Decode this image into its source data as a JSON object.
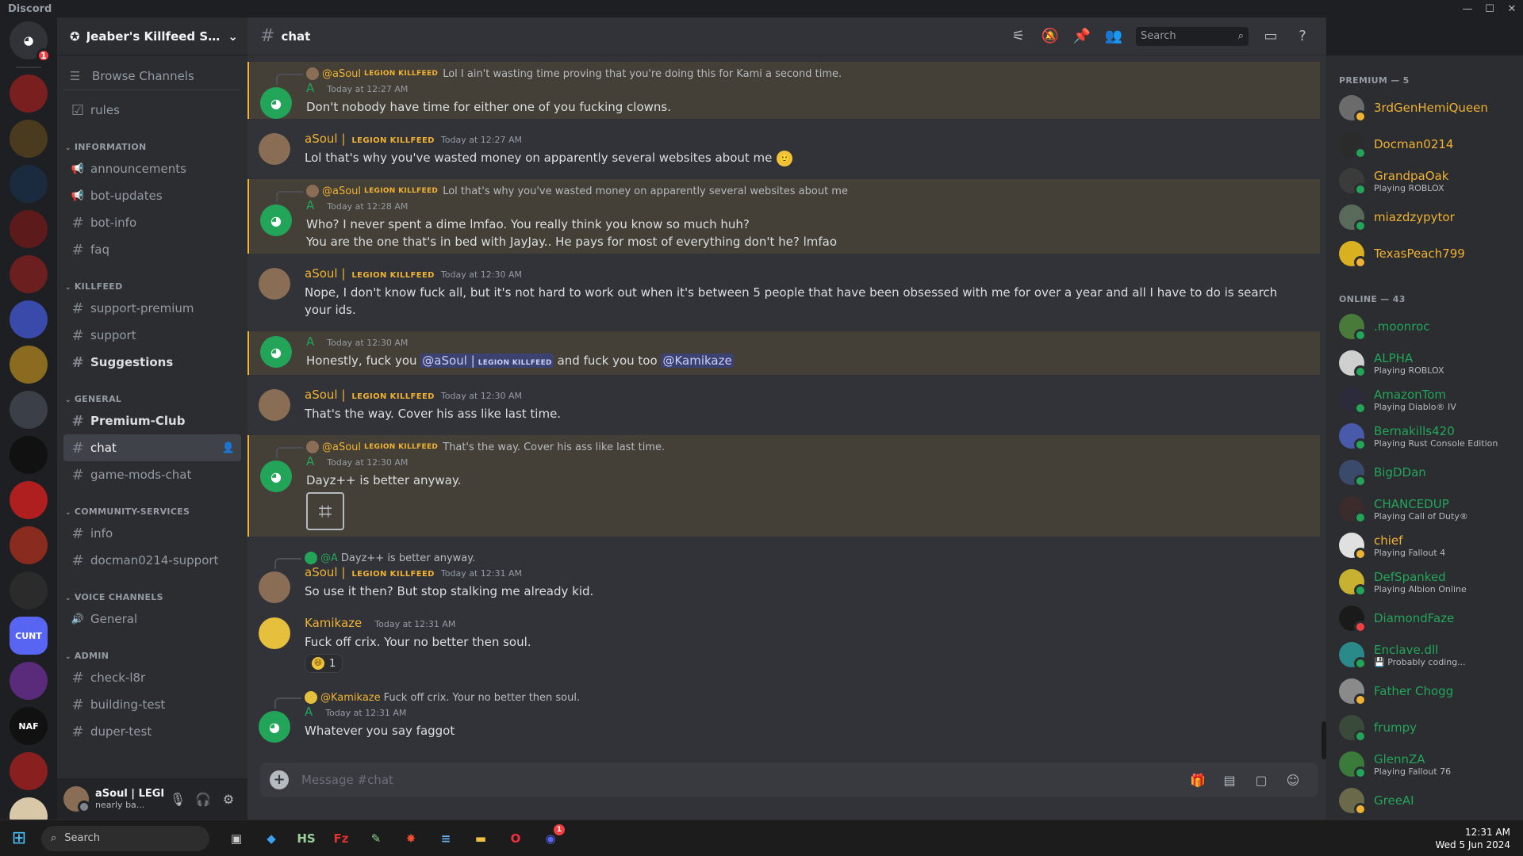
{
  "window": {
    "app_name": "Discord",
    "controls": [
      "—",
      "☐",
      "✕"
    ]
  },
  "servers": [
    {
      "label": "",
      "icon": "discord-home-icon",
      "color": "#313338",
      "badge": "1"
    },
    {
      "label": "",
      "icon": "server-skull-icon",
      "color": "#7a1f1f"
    },
    {
      "label": "",
      "icon": "server-emblem-icon",
      "color": "#4a3b1e"
    },
    {
      "label": "",
      "icon": "server-deathmatch-icon",
      "color": "#1a2b3f"
    },
    {
      "label": "",
      "icon": "server-dayz-icon",
      "color": "#5c1a1a"
    },
    {
      "label": "",
      "icon": "server-skull-red-icon",
      "color": "#6b1f1f"
    },
    {
      "label": "",
      "icon": "folder-icon",
      "color": "#3a4aaa"
    },
    {
      "label": "",
      "icon": "server-gold-icon",
      "color": "#8a6b1f"
    },
    {
      "label": "",
      "icon": "server-mask-icon",
      "color": "#3b4048"
    },
    {
      "label": "",
      "icon": "server-anarchy-icon",
      "color": "#111111"
    },
    {
      "label": "",
      "icon": "server-red-icon",
      "color": "#b01f1f"
    },
    {
      "label": "",
      "icon": "server-target-icon",
      "color": "#8a2b1f"
    },
    {
      "label": "",
      "icon": "server-skull-crown-icon",
      "color": "#2b2b2b"
    },
    {
      "label": "CUNT",
      "icon": "server-text-icon",
      "color": "#5865f2"
    },
    {
      "label": "",
      "icon": "server-purple-icon",
      "color": "#5a2b7a"
    },
    {
      "label": "NAF",
      "icon": "server-naf-icon",
      "color": "#111111"
    },
    {
      "label": "",
      "icon": "server-demon-icon",
      "color": "#8a1f1f"
    },
    {
      "label": "",
      "icon": "server-poster-icon",
      "color": "#d8c8a8"
    }
  ],
  "server": {
    "name": "Jeaber's Killfeed Sup..."
  },
  "sidebar": {
    "browse": "Browse Channels",
    "top_channels": [
      {
        "name": "rules",
        "icon": "rules-icon",
        "glyph": "☑"
      }
    ],
    "categories": [
      {
        "name": "INFORMATION",
        "channels": [
          {
            "name": "announcements",
            "glyph": "📢",
            "icon": "announcement-icon"
          },
          {
            "name": "bot-updates",
            "glyph": "📢",
            "icon": "announcement-icon"
          },
          {
            "name": "bot-info",
            "glyph": "#",
            "icon": "text-channel-icon"
          },
          {
            "name": "faq",
            "glyph": "#",
            "icon": "text-channel-icon"
          }
        ]
      },
      {
        "name": "KILLFEED",
        "channels": [
          {
            "name": "support-premium",
            "glyph": "#",
            "icon": "text-channel-icon"
          },
          {
            "name": "support",
            "glyph": "#",
            "icon": "text-channel-icon"
          },
          {
            "name": "Suggestions",
            "glyph": "#",
            "icon": "text-channel-icon",
            "bold": true
          }
        ]
      },
      {
        "name": "GENERAL",
        "channels": [
          {
            "name": "Premium-Club",
            "glyph": "#",
            "icon": "text-channel-icon",
            "bold": true
          },
          {
            "name": "chat",
            "glyph": "#",
            "icon": "text-channel-icon",
            "active": true
          },
          {
            "name": "game-mods-chat",
            "glyph": "#",
            "icon": "text-channel-icon"
          }
        ]
      },
      {
        "name": "COMMUNITY-SERVICES",
        "channels": [
          {
            "name": "info",
            "glyph": "#",
            "icon": "text-channel-icon"
          },
          {
            "name": "docman0214-support",
            "glyph": "#",
            "icon": "text-channel-icon"
          }
        ]
      },
      {
        "name": "VOICE CHANNELS",
        "channels": [
          {
            "name": "General",
            "glyph": "🔊",
            "icon": "voice-channel-icon"
          }
        ]
      },
      {
        "name": "ADMIN",
        "channels": [
          {
            "name": "check-l8r",
            "glyph": "#",
            "icon": "text-channel-icon"
          },
          {
            "name": "building-test",
            "glyph": "#",
            "icon": "text-channel-icon"
          },
          {
            "name": "duper-test",
            "glyph": "#",
            "icon": "text-channel-icon"
          }
        ]
      }
    ]
  },
  "user_panel": {
    "username": "aSoul | LEGI...",
    "status": "nearly ba..."
  },
  "chat": {
    "channel": "chat",
    "search_placeholder": "Search",
    "composer_placeholder": "Message #chat"
  },
  "messages": [
    {
      "highlight": true,
      "reply": {
        "name": "@aSoul",
        "tag": "LEGION KILLFEED",
        "text": "Lol I ain't wasting time proving that you're doing this for Kami a second time."
      },
      "author": "A",
      "author_style": "green",
      "avatar": "discord",
      "timestamp": "Today at 12:27 AM",
      "lines": [
        "Don't nobody have time for either one of you fucking clowns."
      ]
    },
    {
      "author": "aSoul |",
      "tag": "LEGION KILLFEED",
      "avatar": "soul",
      "timestamp": "Today at 12:27 AM",
      "lines": [
        "Lol that's why you've wasted money on apparently several websites about me"
      ],
      "emoji": "🙂"
    },
    {
      "highlight": true,
      "reply": {
        "name": "@aSoul",
        "tag": "LEGION KILLFEED",
        "text": "Lol that's why you've wasted money on apparently several websites about me"
      },
      "author": "A",
      "author_style": "green",
      "avatar": "discord",
      "timestamp": "Today at 12:28 AM",
      "lines": [
        "Who? I never spent a dime lmfao. You really think you know so much huh?",
        "You are the one that's in bed with JayJay.. He pays for most of everything don't he? lmfao"
      ]
    },
    {
      "author": "aSoul |",
      "tag": "LEGION KILLFEED",
      "avatar": "soul",
      "timestamp": "Today at 12:30 AM",
      "lines": [
        "Nope, I don't know fuck all, but it's not hard to work out when it's between 5 people that have been obsessed with me for over a year and all I have to do is search your ids."
      ]
    },
    {
      "highlight": true,
      "author": "A",
      "author_style": "green",
      "avatar": "discord",
      "timestamp": "Today at 12:30 AM",
      "mention_line": {
        "before": "Honestly, fuck you ",
        "mention1": "@aSoul |",
        "mention1_tag": "LEGION KILLFEED",
        "middle": " and fuck you too ",
        "mention2": "@Kamikaze"
      }
    },
    {
      "author": "aSoul |",
      "tag": "LEGION KILLFEED",
      "avatar": "soul",
      "timestamp": "Today at 12:30 AM",
      "lines": [
        "That's the way. Cover his ass like last time."
      ]
    },
    {
      "highlight": true,
      "reply": {
        "name": "@aSoul",
        "tag": "LEGION KILLFEED",
        "text": "That's the way. Cover his ass like last time."
      },
      "author": "A",
      "author_style": "green",
      "avatar": "discord",
      "timestamp": "Today at 12:30 AM",
      "lines": [
        "Dayz++ is better anyway."
      ],
      "sticker": true
    },
    {
      "reply": {
        "name": "@A",
        "tag": "",
        "text": "Dayz++ is better anyway.",
        "green": true
      },
      "author": "aSoul |",
      "tag": "LEGION KILLFEED",
      "avatar": "soul",
      "timestamp": "Today at 12:31 AM",
      "lines": [
        "So use it then? But stop stalking me already kid."
      ]
    },
    {
      "author": "Kamikaze",
      "author_style": "kami",
      "avatar": "kami",
      "timestamp": "Today at 12:31 AM",
      "lines": [
        "Fuck off crix. Your no better then soul."
      ],
      "reaction": {
        "count": "1"
      }
    },
    {
      "reply": {
        "name": "@Kamikaze",
        "tag": "",
        "text": "Fuck off crix. Your no better then soul."
      },
      "author": "A",
      "author_style": "green",
      "avatar": "discord",
      "timestamp": "Today at 12:31 AM",
      "lines": [
        "Whatever you say faggot"
      ]
    }
  ],
  "members": {
    "groups": [
      {
        "title": "PREMIUM — 5",
        "items": [
          {
            "name": "3rdGenHemiQueen",
            "activity": "",
            "color": "#f0b232",
            "avatar": "#6b6b6b",
            "status": "#f0b232"
          },
          {
            "name": "Docman0214",
            "activity": "",
            "color": "#f0b232",
            "avatar": "#2b2b2b",
            "status": "#23a559"
          },
          {
            "name": "GrandpaOak",
            "activity": "Playing ROBLOX",
            "color": "#f0b232",
            "avatar": "#3b3b3b",
            "status": "#23a559"
          },
          {
            "name": "miazdzypytor",
            "activity": "",
            "color": "#f0b232",
            "avatar": "#5a6a5a",
            "status": "#23a559"
          },
          {
            "name": "TexasPeach799",
            "activity": "",
            "color": "#f0b232",
            "avatar": "#d8b020",
            "status": "#f0b232"
          }
        ]
      },
      {
        "title": "ONLINE — 43",
        "items": [
          {
            "name": ".moonroc",
            "activity": "",
            "color": "#23a559",
            "avatar": "#4a7a3a",
            "status": "#23a559"
          },
          {
            "name": "ALPHA",
            "activity": "Playing ROBLOX",
            "color": "#23a559",
            "avatar": "#cfcfcf",
            "status": "#23a559"
          },
          {
            "name": "AmazonTom",
            "activity": "Playing Diablo® IV",
            "color": "#23a559",
            "avatar": "#2b2b3b",
            "status": "#23a559"
          },
          {
            "name": "Bernakills420",
            "activity": "Playing Rust Console Edition",
            "color": "#23a559",
            "avatar": "#4a5aaa",
            "status": "#23a559"
          },
          {
            "name": "BigDDan",
            "activity": "",
            "color": "#23a559",
            "avatar": "#3a4a6a",
            "status": "#23a559"
          },
          {
            "name": "CHANCEDUP",
            "activity": "Playing Call of Duty®",
            "color": "#23a559",
            "avatar": "#3b2b2b",
            "status": "#23a559"
          },
          {
            "name": "chief",
            "activity": "Playing Fallout 4",
            "color": "#f0b232",
            "avatar": "#e0e0e0",
            "status": "#f0b232"
          },
          {
            "name": "DefSpanked",
            "activity": "Playing Albion Online",
            "color": "#23a559",
            "avatar": "#c8b030",
            "status": "#23a559"
          },
          {
            "name": "DiamondFaze",
            "activity": "",
            "color": "#23a559",
            "avatar": "#1a1a1a",
            "status": "#f23f43"
          },
          {
            "name": "Enclave.dll",
            "activity": "💾 Probably coding...",
            "color": "#23a559",
            "avatar": "#2a8a8a",
            "status": "#23a559"
          },
          {
            "name": "Father Chogg",
            "activity": "",
            "color": "#23a559",
            "avatar": "#8a8a8a",
            "status": "#f0b232"
          },
          {
            "name": "frumpy",
            "activity": "",
            "color": "#23a559",
            "avatar": "#3a4a3a",
            "status": "#23a559"
          },
          {
            "name": "GlennZA",
            "activity": "Playing Fallout 76",
            "color": "#23a559",
            "avatar": "#3a7a3a",
            "status": "#23a559"
          },
          {
            "name": "GreeAI",
            "activity": "",
            "color": "#23a559",
            "avatar": "#6a6a4a",
            "status": "#f0b232"
          }
        ]
      }
    ]
  },
  "taskbar": {
    "search": "Search",
    "apps": [
      {
        "name": "task-view",
        "glyph": "▣",
        "color": "#cfcfcf"
      },
      {
        "name": "vscode",
        "glyph": "◆",
        "color": "#3aa0f0"
      },
      {
        "name": "hashtab",
        "glyph": "HS",
        "color": "#9ad09a"
      },
      {
        "name": "filezilla",
        "glyph": "Fz",
        "color": "#e03030"
      },
      {
        "name": "notepad-plus",
        "glyph": "✎",
        "color": "#8ad08a"
      },
      {
        "name": "hoppscotch",
        "glyph": "✸",
        "color": "#f05030"
      },
      {
        "name": "notepad",
        "glyph": "≡",
        "color": "#6ab0f0"
      },
      {
        "name": "file-explorer",
        "glyph": "▬",
        "color": "#f0c040"
      },
      {
        "name": "opera",
        "glyph": "O",
        "color": "#f03040"
      },
      {
        "name": "discord",
        "glyph": "◉",
        "color": "#5865f2",
        "badge": "1"
      }
    ],
    "time": "12:31 AM",
    "date": "Wed 5 Jun 2024"
  }
}
